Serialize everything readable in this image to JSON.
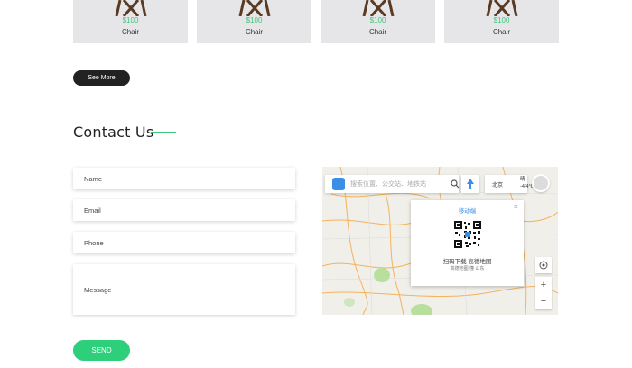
{
  "products": [
    {
      "price": "$100",
      "name": "Chair"
    },
    {
      "price": "$100",
      "name": "Chair"
    },
    {
      "price": "$100",
      "name": "Chair"
    },
    {
      "price": "$100",
      "name": "Chair"
    }
  ],
  "see_more_label": "See More",
  "contact": {
    "title": "Contact Us",
    "fields": {
      "name_placeholder": "Name",
      "email_placeholder": "Email",
      "phone_placeholder": "Phone",
      "message_placeholder": "Message"
    },
    "send_label": "SEND"
  },
  "map": {
    "search_placeholder": "搜索位置、公交站、地铁站",
    "city": "北京",
    "weather_line1": "晴",
    "weather_line2": "-4/4°C",
    "popup_title": "移动端",
    "popup_line1": "扫码下载 高德地图",
    "popup_line2": "高德地图 懂 山东",
    "popup_close": "×",
    "zoom_in": "+",
    "zoom_out": "−"
  },
  "colors": {
    "accent": "#2dcf7a",
    "price": "#3cc87a",
    "dark_button": "#222222",
    "map_blue": "#3a8ee6"
  }
}
